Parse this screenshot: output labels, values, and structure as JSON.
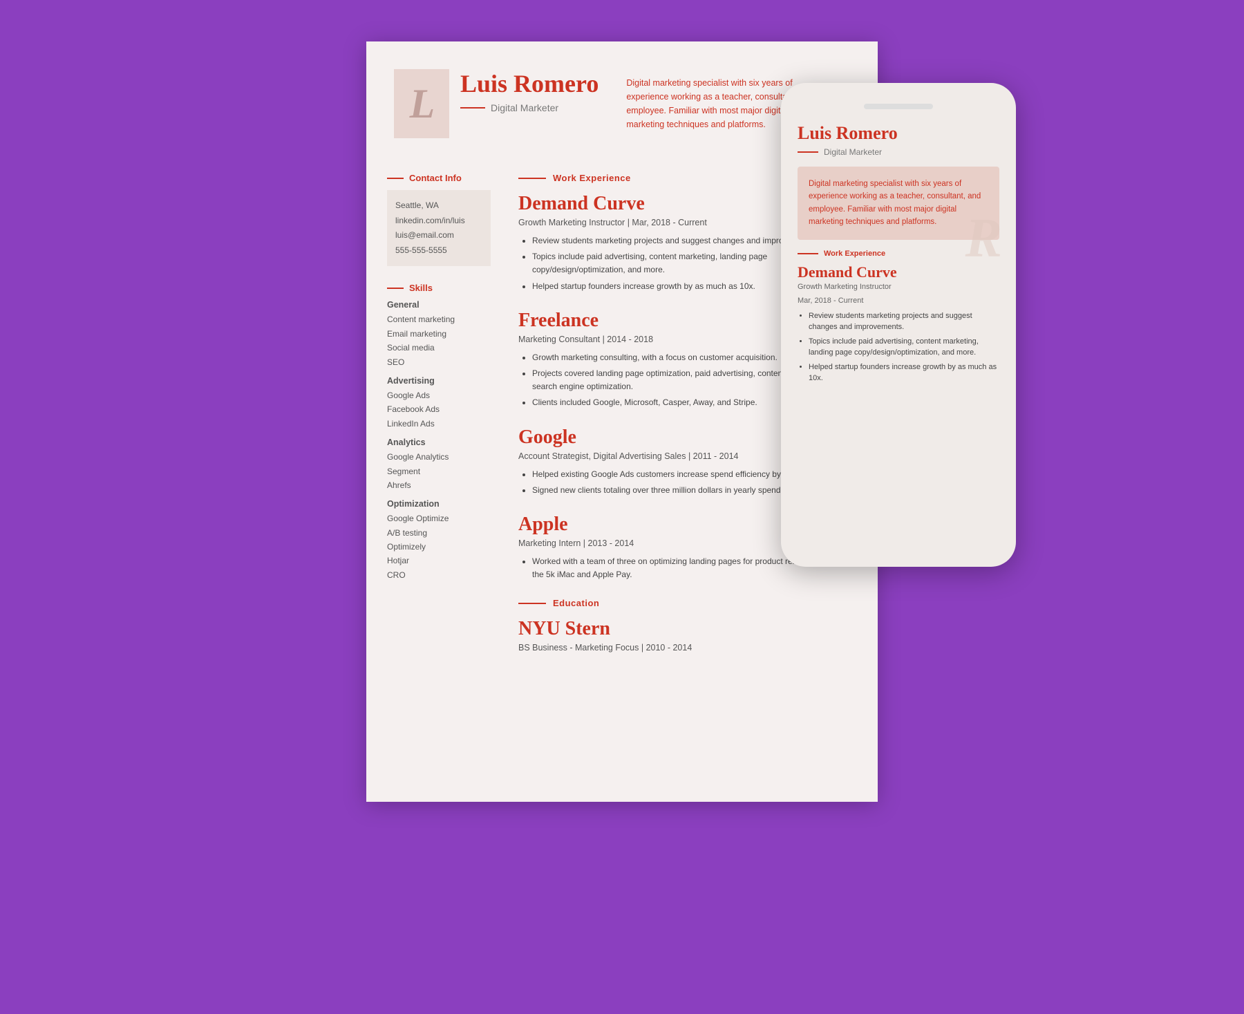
{
  "page": {
    "background_color": "#8B3FBF"
  },
  "resume": {
    "name": "Luis Romero",
    "title": "Digital Marketer",
    "monogram": "L",
    "summary": "Digital marketing specialist with six years of experience working as a teacher, consultant, and employee. Familiar with most major digital marketing techniques and platforms.",
    "contact": {
      "label": "Contact Info",
      "location": "Seattle, WA",
      "linkedin": "linkedin.com/in/luis",
      "email": "luis@email.com",
      "phone": "555-555-5555"
    },
    "skills": {
      "label": "Skills",
      "categories": [
        {
          "title": "General",
          "items": [
            "Content marketing",
            "Email marketing",
            "Social media",
            "SEO"
          ]
        },
        {
          "title": "Advertising",
          "items": [
            "Google Ads",
            "Facebook Ads",
            "LinkedIn Ads"
          ]
        },
        {
          "title": "Analytics",
          "items": [
            "Google Analytics",
            "Segment",
            "Ahrefs"
          ]
        },
        {
          "title": "Optimization",
          "items": [
            "Google Optimize",
            "A/B testing",
            "Optimizely",
            "Hotjar",
            "CRO"
          ]
        }
      ]
    },
    "work_experience": {
      "label": "Work Experience",
      "jobs": [
        {
          "company": "Demand Curve",
          "role": "Growth Marketing Instructor | Mar, 2018 - Current",
          "bullets": [
            "Review students marketing projects and suggest changes and improvements.",
            "Topics include paid advertising, content marketing, landing page copy/design/optimization, and more.",
            "Helped startup founders increase growth by as much as 10x."
          ]
        },
        {
          "company": "Freelance",
          "role": "Marketing Consultant | 2014 - 2018",
          "bullets": [
            "Growth marketing consulting, with a focus on customer acquisition.",
            "Projects covered landing page optimization, paid advertising, content marketing and search engine optimization.",
            "Clients included Google, Microsoft, Casper, Away, and Stripe."
          ]
        },
        {
          "company": "Google",
          "role": "Account Strategist, Digital Advertising Sales | 2011 - 2014",
          "bullets": [
            "Helped existing Google Ads customers increase spend efficiency by up to 2x.",
            "Signed new clients totaling over three million dollars in yearly spend."
          ]
        },
        {
          "company": "Apple",
          "role": "Marketing Intern | 2013 - 2014",
          "bullets": [
            "Worked with a team of three on optimizing landing pages for product releases, including the 5k iMac and Apple Pay."
          ]
        }
      ]
    },
    "education": {
      "label": "Education",
      "school": "NYU Stern",
      "degree": "BS Business - Marketing Focus | 2010 - 2014"
    }
  },
  "mobile_preview": {
    "name": "Luis Romero",
    "title": "Digital Marketer",
    "monogram": "R",
    "summary": "Digital marketing specialist with six years of experience working as a teacher, consultant, and employee. Familiar with most major digital marketing techniques and platforms.",
    "work_label": "Work Experience",
    "job_company": "Demand Curve",
    "job_role_line1": "Growth Marketing Instructor",
    "job_role_line2": "Mar, 2018 - Current",
    "bullets": [
      "Review students marketing projects and suggest changes and improvements.",
      "Topics include paid advertising, content marketing, landing page copy/design/optimization, and more.",
      "Helped startup founders increase growth by as much as 10x."
    ]
  }
}
